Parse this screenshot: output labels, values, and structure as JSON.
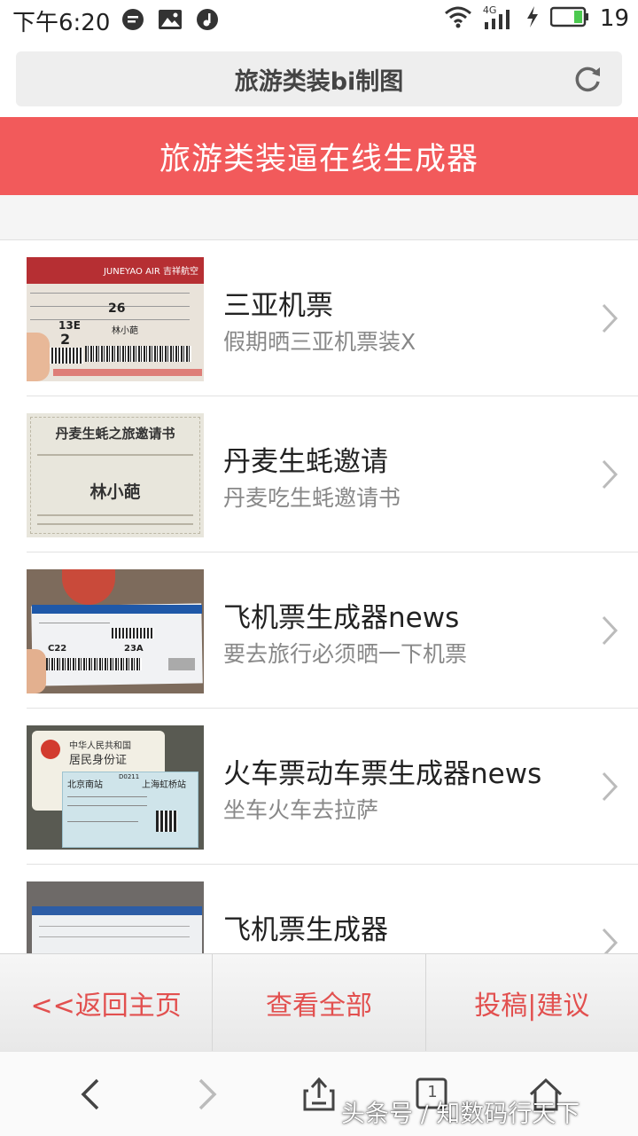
{
  "status_bar": {
    "time": "下午6:20",
    "network": "4G",
    "battery": "19",
    "icons": [
      "message-icon",
      "image-icon",
      "music-icon",
      "wifi-icon",
      "signal-icon",
      "charging-icon",
      "battery-icon"
    ]
  },
  "browser": {
    "page_title": "旅游类装bi制图"
  },
  "header": {
    "title": "旅游类装逼在线生成器"
  },
  "items": [
    {
      "title": "三亚机票",
      "subtitle": "假期晒三亚机票装X"
    },
    {
      "title": "丹麦生蚝邀请",
      "subtitle": "丹麦吃生蚝邀请书"
    },
    {
      "title": "飞机票生成器news",
      "subtitle": "要去旅行必须晒一下机票"
    },
    {
      "title": "火车票动车票生成器news",
      "subtitle": "坐车火车去拉萨"
    },
    {
      "title": "飞机票生成器",
      "subtitle": ""
    }
  ],
  "thumbnails": {
    "sanya": {
      "airline": "JUNEYAO AIR 吉祥航空",
      "gate": "26",
      "seat": "13E",
      "seq": "2",
      "name": "林小葩"
    },
    "denmark": {
      "heading": "丹麦生蚝之旅邀请书",
      "name": "林小葩"
    },
    "boarding": {
      "seat1": "C22",
      "seat2": "23A"
    },
    "train": {
      "id_title": "中华人民共和国",
      "id_sub": "居民身份证",
      "from": "北京南站",
      "to": "上海虹桥站",
      "train_no": "D0211"
    }
  },
  "actions": {
    "home": "<<返回主页",
    "all": "查看全部",
    "submit": "投稿|建议"
  },
  "nav": {
    "tabs": "1"
  },
  "watermark": "头条号 / 知数码行天下",
  "colors": {
    "accent": "#f25a5b",
    "action_text": "#e2504f"
  }
}
